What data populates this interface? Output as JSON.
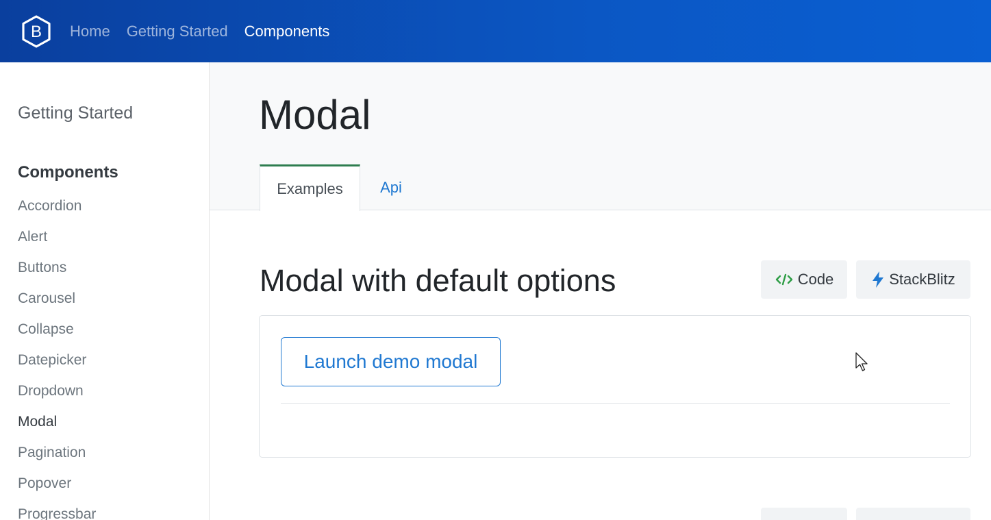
{
  "navbar": {
    "logo_letter": "B",
    "links": [
      {
        "label": "Home",
        "active": false
      },
      {
        "label": "Getting Started",
        "active": false
      },
      {
        "label": "Components",
        "active": true
      }
    ]
  },
  "sidebar": {
    "top_link": "Getting Started",
    "section_heading": "Components",
    "items": [
      "Accordion",
      "Alert",
      "Buttons",
      "Carousel",
      "Collapse",
      "Datepicker",
      "Dropdown",
      "Modal",
      "Pagination",
      "Popover",
      "Progressbar"
    ],
    "current_item": "Modal"
  },
  "page": {
    "title": "Modal",
    "tabs": [
      {
        "label": "Examples",
        "active": true
      },
      {
        "label": "Api",
        "active": false
      }
    ]
  },
  "section": {
    "title": "Modal with default options",
    "code_button": "Code",
    "stackblitz_button": "StackBlitz",
    "launch_button": "Launch demo modal"
  },
  "colors": {
    "navbar": "#0b57c4",
    "link_blue": "#1f78d1",
    "tab_accent": "#2e7d4f",
    "code_icon": "#2e9d46"
  },
  "icons": {
    "logo": "bootstrap-hexagon-icon",
    "code": "code-brackets-icon",
    "stackblitz": "lightning-bolt-icon",
    "cursor": "mouse-pointer-icon"
  }
}
